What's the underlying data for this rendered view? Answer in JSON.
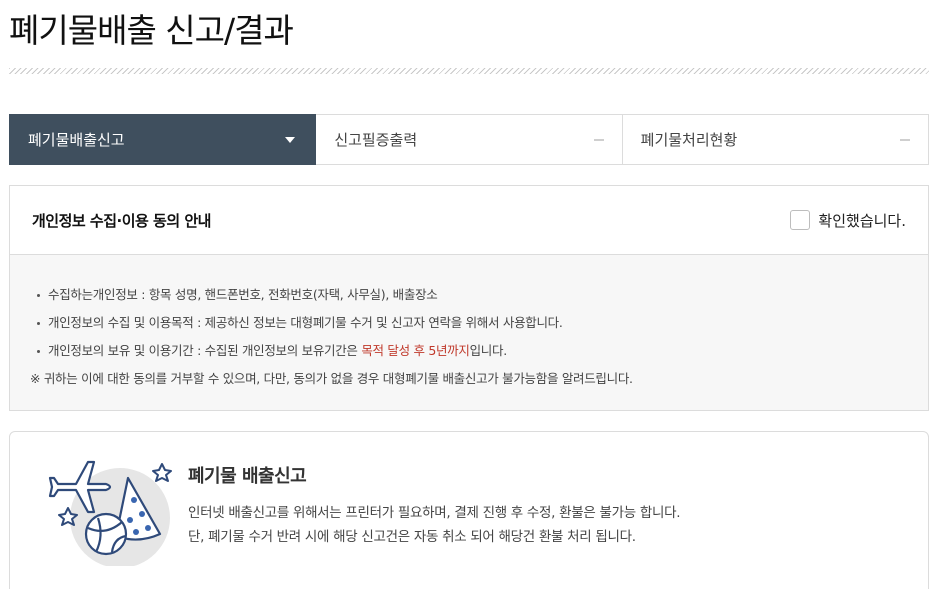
{
  "page": {
    "title": "폐기물배출 신고/결과"
  },
  "steps": [
    {
      "label": "폐기물배출신고",
      "state": "active",
      "icon": "caret-down-icon"
    },
    {
      "label": "신고필증출력",
      "state": "inactive",
      "icon": "dash-icon"
    },
    {
      "label": "폐기물처리현황",
      "state": "inactive",
      "icon": "dash-icon"
    }
  ],
  "consent": {
    "title": "개인정보 수집·이용 동의 안내",
    "confirm_label": "확인했습니다.",
    "checked": false,
    "items": [
      "수집하는개인정보 : 항목 성명, 핸드폰번호, 전화번호(자택, 사무실), 배출장소",
      "개인정보의 수집 및 이용목적 : 제공하신 정보는 대형폐기물 수거 및 신고자 연락을 위해서 사용합니다.",
      "개인정보의 보유 및 이용기간 : 수집된 개인정보의 보유기간은 "
    ],
    "item3_highlight": "목적 달성 후 5년까지",
    "item3_suffix": "입니다.",
    "note": "※ 귀하는 이에 대한 동의를 거부할 수 있으며, 다만, 동의가 없을 경우 대형폐기물 배출신고가 불가능함을 알려드립니다."
  },
  "report": {
    "title": "폐기물 배출신고",
    "line1": "인터넷 배출신고를 위해서는 프린터가 필요하며, 결제 진행 후 수정, 환불은 불가능 합니다.",
    "line2": "단, 폐기물 수거 반려 시에 해당 신고건은 자동 취소 되어 해당건 환불 처리 됩니다.",
    "illustration": "waste-items-illustration"
  },
  "colors": {
    "active_step_bg": "#3f4f5e",
    "highlight_text": "#c0392b",
    "illustration_navy": "#2f4a7a",
    "illustration_circle": "#e6e6e6"
  }
}
